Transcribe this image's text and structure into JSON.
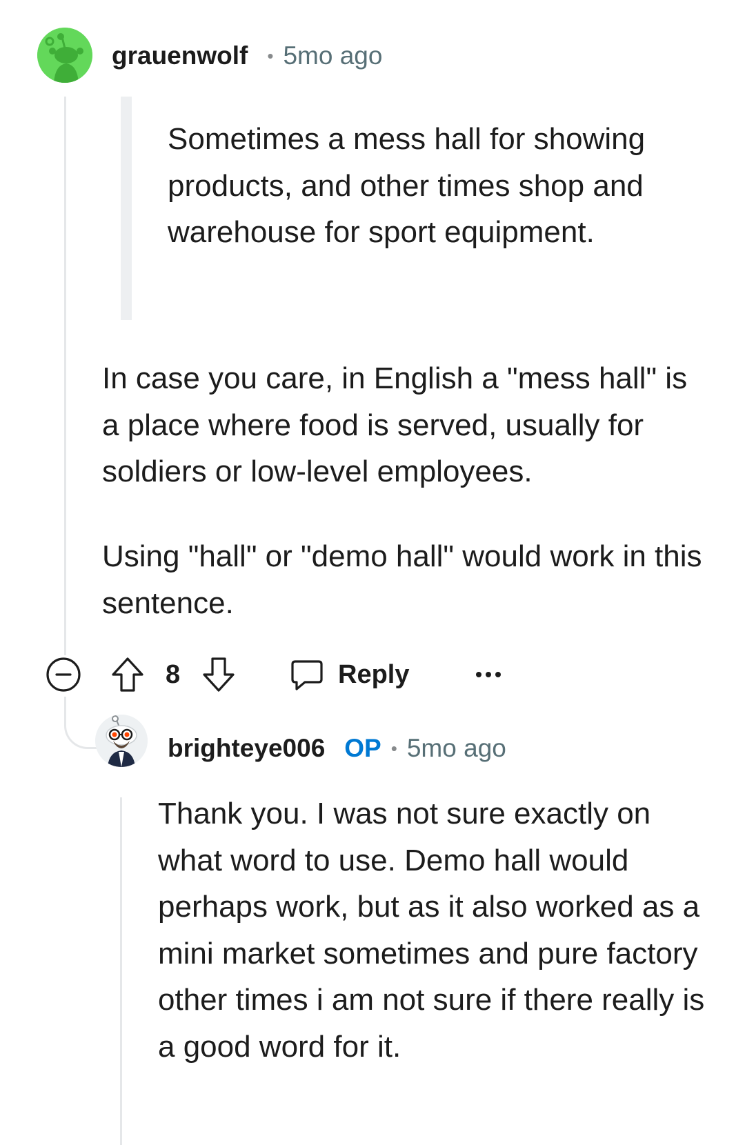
{
  "comments": [
    {
      "author": "grauenwolf",
      "separator": "•",
      "timestamp": "5mo ago",
      "quote": "Sometimes a mess hall for showing products, and other times shop and warehouse for sport equipment.",
      "paragraphs": [
        "In case you care, in English a \"mess hall\" is a place where food is served, usually for soldiers or low-level employees.",
        "Using \"hall\" or \"demo hall\" would work in this sentence."
      ],
      "actions": {
        "vote_count": "8",
        "reply_label": "Reply"
      },
      "avatar_color": "#63d85a"
    },
    {
      "author": "brighteye006",
      "badge": "OP",
      "separator": "•",
      "timestamp": "5mo ago",
      "paragraphs": [
        "Thank you. I was not sure exactly on what word to use. Demo hall would perhaps work, but as it also worked as a mini market sometimes and pure factory other times i am not sure if there really is a good word for it."
      ],
      "badge_color": "#0079d3"
    }
  ],
  "icons": {
    "collapse": "minus-circle-icon",
    "upvote": "arrow-up-icon",
    "downvote": "arrow-down-icon",
    "reply": "speech-bubble-icon",
    "more": "ellipsis-icon"
  }
}
